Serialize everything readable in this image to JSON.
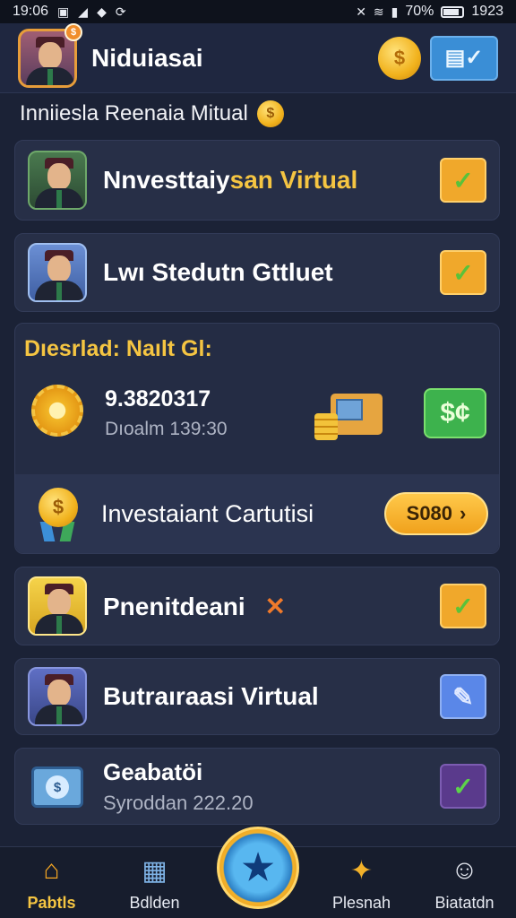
{
  "status_bar": {
    "time": "19:06",
    "battery_percent": "70%",
    "clock_right": "1923"
  },
  "header": {
    "title": "Niduiasai",
    "avatar_badge": "$",
    "coin_symbol": "$",
    "action_icon": "chart-check-icon"
  },
  "subtitle": {
    "text": "Inniiesla Reenaia Mitual",
    "coin_symbol": "$"
  },
  "cards": [
    {
      "label_main": "Nnvesttaiy",
      "label_accent": "san Virtual",
      "button_symbol": "✓"
    },
    {
      "label_main": "Lwı Stedutn Gttluet",
      "button_symbol": "✓"
    }
  ],
  "panel": {
    "title": "Dıesrlad: Naılt Gl:",
    "stat_value": "9.3820317",
    "stat_sub": "Dıoalm 139:30",
    "cash_label": "$¢",
    "investment_label": "Investaiant Cartutisi",
    "investment_button": "S080",
    "investment_chevron": "›",
    "medal_symbol": "$"
  },
  "list": [
    {
      "label": "Pnenitdeani",
      "label_symbol": "✕",
      "button_symbol": "✓"
    },
    {
      "label": "Butraıraasi Virtual",
      "button_symbol": "✎"
    },
    {
      "label": "Geabatöi",
      "sublabel": "Syroddan 222.20",
      "button_symbol": "✓",
      "cash_symbol": "$"
    }
  ],
  "bottom_nav": {
    "items": [
      {
        "label": "Pabtls",
        "icon": "home-icon"
      },
      {
        "label": "Bdlden",
        "icon": "chart-icon"
      },
      {
        "label": "Plesnah",
        "icon": "rocket-icon"
      },
      {
        "label": "Biatatdn",
        "icon": "person-icon"
      }
    ],
    "center_icon": "star-icon"
  },
  "colors": {
    "background": "#1b2236",
    "accent_gold": "#f5c542",
    "button_orange": "#f0a82b",
    "button_blue": "#5a87e8",
    "button_purple": "#5a3a8c"
  }
}
